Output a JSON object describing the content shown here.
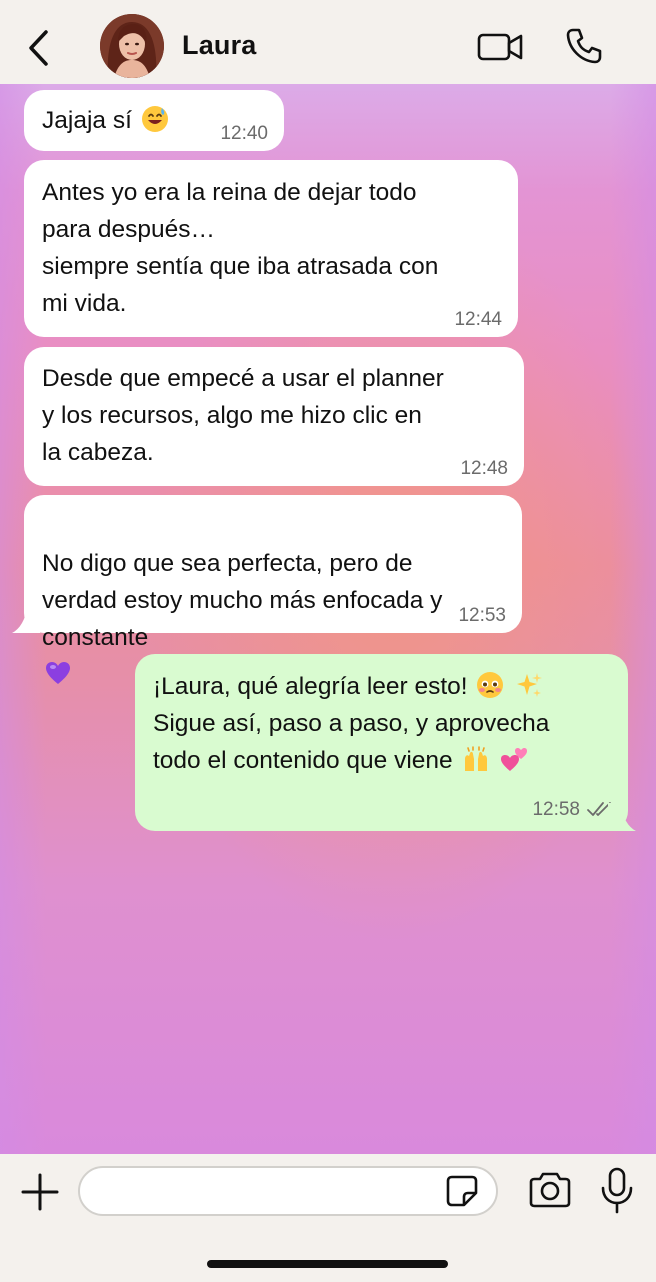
{
  "header": {
    "contact_name": "Laura",
    "icons": {
      "back": "chevron-left-icon",
      "video": "video-camera-icon",
      "call": "phone-icon"
    }
  },
  "messages": [
    {
      "direction": "incoming",
      "text": "Jajaja sí",
      "emoji": [
        "grinning-sweat-face"
      ],
      "time": "12:40"
    },
    {
      "direction": "incoming",
      "text": "Antes yo era la reina de dejar todo\npara después…\nsiempre sentía que iba atrasada con\nmi vida.",
      "time": "12:44"
    },
    {
      "direction": "incoming",
      "text": "Desde que empecé a usar el planner\ny los recursos, algo me hizo clic en\nla cabeza.",
      "time": "12:48"
    },
    {
      "direction": "incoming",
      "text": "No digo que sea perfecta, pero de\nverdad estoy mucho más enfocada y\nconstante",
      "emoji": [
        "purple-heart"
      ],
      "time": "12:53"
    },
    {
      "direction": "outgoing",
      "lines": [
        "¡Laura, qué alegría leer esto!",
        "Sigue así, paso a paso, y aprovecha",
        "todo el contenido que viene"
      ],
      "emoji": [
        "face-holding-back-tears",
        "sparkles",
        "raising-hands",
        "two-hearts"
      ],
      "time": "12:58",
      "status": "read-double-check"
    }
  ],
  "composer": {
    "value": "",
    "placeholder": "",
    "icons": {
      "attach": "plus-icon",
      "sticker": "sticker-icon",
      "camera": "camera-icon",
      "mic": "microphone-icon"
    }
  },
  "colors": {
    "incoming_bubble": "#ffffff",
    "outgoing_bubble": "#d9fbd0",
    "bars": "#f4f1ed",
    "timestamp": "#6b6b6b"
  }
}
